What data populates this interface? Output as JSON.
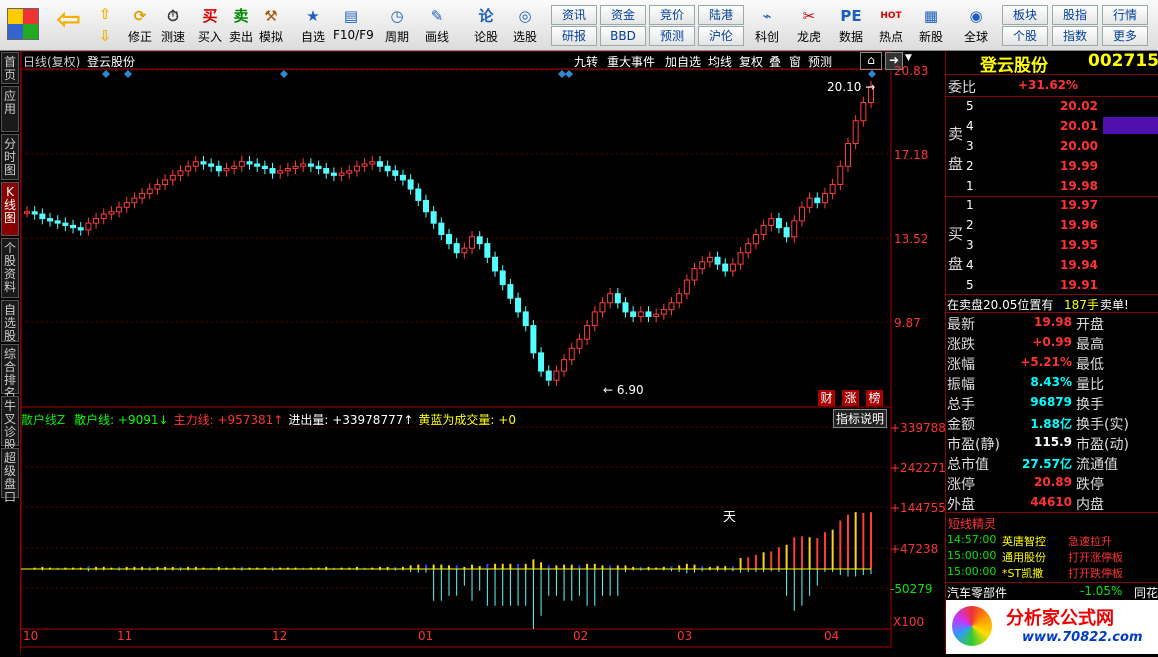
{
  "toolbar": {
    "main": [
      {
        "name": "modify",
        "label": "修正",
        "icon": "⟳"
      },
      {
        "name": "test",
        "label": "测速",
        "icon": "⏱"
      },
      {
        "name": "buy",
        "label": "买入",
        "icon": "买"
      },
      {
        "name": "sell",
        "label": "卖出",
        "icon": "卖"
      },
      {
        "name": "simulate",
        "label": "模拟",
        "icon": "⚒"
      },
      {
        "name": "self-select",
        "label": "自选",
        "icon": "★"
      },
      {
        "name": "f10",
        "label": "F10/F9",
        "icon": "▤"
      },
      {
        "name": "period",
        "label": "周期",
        "icon": "◷"
      },
      {
        "name": "draw",
        "label": "画线",
        "icon": "✎"
      },
      {
        "name": "lungu",
        "label": "论股",
        "icon": "论"
      },
      {
        "name": "pick",
        "label": "选股",
        "icon": "◎"
      },
      {
        "name": "kechuang",
        "label": "科创",
        "icon": "⌁"
      },
      {
        "name": "longhu",
        "label": "龙虎",
        "icon": "✂"
      },
      {
        "name": "data",
        "label": "数据",
        "icon": "PE"
      },
      {
        "name": "hot",
        "label": "热点",
        "icon": "HOT"
      },
      {
        "name": "new-stock",
        "label": "新股",
        "icon": "▦"
      },
      {
        "name": "global",
        "label": "全球",
        "icon": "◉"
      }
    ],
    "mini": [
      "资讯",
      "资金",
      "竞价",
      "陆港",
      "研报",
      "BBD",
      "预测",
      "沪伦"
    ],
    "mini_right": [
      "板块",
      "股指",
      "行情",
      "个股",
      "指数",
      "更多"
    ]
  },
  "left_tabs": [
    "首页",
    "应用",
    "分时图",
    "K线图",
    "个股资料",
    "自选股",
    "综合排名",
    "牛叉诊股",
    "超级盘口"
  ],
  "chart": {
    "header_left": "日线(复权)",
    "stock_name": "登云股份",
    "header_buttons": [
      "九转",
      "重大事件",
      "加自选",
      "均线",
      "复权",
      "叠",
      "窗",
      "预测"
    ],
    "price_axis": [
      "20.83",
      "17.18",
      "13.52",
      "9.87"
    ],
    "high_label": "20.10",
    "low_label": "6.90",
    "badges": [
      "财",
      "涨",
      "榜"
    ],
    "indicator_button": "指标说明",
    "ind_title": "散户线Z",
    "ind_parts": [
      {
        "t": "散户线: +9091↓",
        "c": "#00ff00"
      },
      {
        "t": "主力线: +957381↑",
        "c": "#ff3232"
      },
      {
        "t": "进出量: +33978777↑",
        "c": "#ffffff"
      },
      {
        "t": "黄蓝为成交量: +0",
        "c": "#ffff00"
      }
    ],
    "ind_axis": [
      "+339788",
      "+242271",
      "+144755",
      "+47238",
      "-50279"
    ],
    "unit": "X100",
    "tian": "天",
    "months": [
      "10",
      "11",
      "12",
      "01",
      "02",
      "03",
      "04"
    ]
  },
  "chart_data": {
    "type": "candlestick",
    "title": "登云股份 日线(复权)",
    "ylim": [
      6.9,
      20.83
    ],
    "high": 20.1,
    "low": 6.9,
    "closes": [
      14.6,
      14.5,
      14.3,
      14.2,
      14.1,
      14.0,
      13.9,
      13.8,
      14.1,
      14.3,
      14.5,
      14.6,
      14.8,
      15.0,
      15.2,
      15.4,
      15.6,
      15.8,
      16.0,
      16.2,
      16.4,
      16.6,
      16.8,
      16.7,
      16.6,
      16.4,
      16.5,
      16.6,
      16.8,
      16.7,
      16.6,
      16.5,
      16.3,
      16.4,
      16.5,
      16.6,
      16.7,
      16.6,
      16.5,
      16.3,
      16.2,
      16.3,
      16.4,
      16.6,
      16.7,
      16.8,
      16.6,
      16.4,
      16.2,
      16.0,
      15.6,
      15.1,
      14.6,
      14.1,
      13.6,
      13.2,
      12.8,
      13.0,
      13.5,
      13.2,
      12.6,
      12.0,
      11.4,
      10.8,
      10.2,
      9.6,
      8.4,
      7.6,
      7.2,
      7.6,
      8.1,
      8.6,
      9.0,
      9.6,
      10.2,
      10.6,
      11.0,
      10.6,
      10.2,
      10.0,
      10.2,
      10.0,
      10.1,
      10.3,
      10.6,
      11.0,
      11.6,
      12.1,
      12.4,
      12.6,
      12.3,
      12.0,
      12.3,
      12.8,
      13.2,
      13.6,
      14.0,
      14.3,
      13.9,
      13.5,
      14.2,
      14.8,
      15.2,
      15.0,
      15.4,
      15.8,
      16.6,
      17.6,
      18.6,
      19.4,
      20.1
    ],
    "indicator": {
      "name": "散户线Z",
      "散户线": 9091,
      "主力线": 957381,
      "进出量": 33978777,
      "黄蓝为成交量": 0,
      "ylim": [
        -50279,
        339788
      ],
      "unit": "X100"
    },
    "x_ticks": [
      "10",
      "11",
      "12",
      "01",
      "02",
      "03",
      "04"
    ]
  },
  "right": {
    "stock_name": "登云股份",
    "code": "002715",
    "weibi_label": "委比",
    "weibi": "+31.62%",
    "sell_label": [
      "卖",
      "盘"
    ],
    "buy_label": [
      "买",
      "盘"
    ],
    "asks": [
      {
        "n": "5",
        "p": "20.02"
      },
      {
        "n": "4",
        "p": "20.01"
      },
      {
        "n": "3",
        "p": "20.00"
      },
      {
        "n": "2",
        "p": "19.99"
      },
      {
        "n": "1",
        "p": "19.98"
      }
    ],
    "bids": [
      {
        "n": "1",
        "p": "19.97"
      },
      {
        "n": "2",
        "p": "19.96"
      },
      {
        "n": "3",
        "p": "19.95"
      },
      {
        "n": "4",
        "p": "19.94"
      },
      {
        "n": "5",
        "p": "19.91"
      }
    ],
    "sell_note": "在卖盘20.05位置有",
    "sell_hands": "187手",
    "sell_tail": "卖单!",
    "stats": [
      {
        "l": "最新",
        "v": "19.98",
        "r": "开盘",
        "c": "#ff3232"
      },
      {
        "l": "涨跌",
        "v": "+0.99",
        "r": "最高",
        "c": "#ff3232"
      },
      {
        "l": "涨幅",
        "v": "+5.21%",
        "r": "最低",
        "c": "#ff3232"
      },
      {
        "l": "振幅",
        "v": "8.43%",
        "r": "量比",
        "c": "#00ffff"
      },
      {
        "l": "总手",
        "v": "96879",
        "r": "换手",
        "c": "#00ffff"
      },
      {
        "l": "金额",
        "v": "1.88亿",
        "r": "换手(实)",
        "c": "#00ffff"
      },
      {
        "l": "市盈(静)",
        "v": "115.9",
        "r": "市盈(动)",
        "c": "#ffffff"
      },
      {
        "l": "总市值",
        "v": "27.57亿",
        "r": "流通值",
        "c": "#00ffff"
      },
      {
        "l": "涨停",
        "v": "20.89",
        "r": "跌停",
        "c": "#ff3232"
      },
      {
        "l": "外盘",
        "v": "44610",
        "r": "内盘",
        "c": "#ff3232"
      }
    ],
    "genie_title": "短线精灵",
    "genie": [
      {
        "t": "14:57:00",
        "s": "英唐智控",
        "e": "急速拉升"
      },
      {
        "t": "15:00:00",
        "s": "通用股份",
        "e": "打开涨停板"
      },
      {
        "t": "15:00:00",
        "s": "*ST凯撒",
        "e": "打开跌停板"
      }
    ],
    "sector": "汽车零部件",
    "sector_pct": "-1.05%",
    "sector_tail": "同花",
    "logo_text": "分析家公式网",
    "logo_url": "www.70822.com"
  }
}
